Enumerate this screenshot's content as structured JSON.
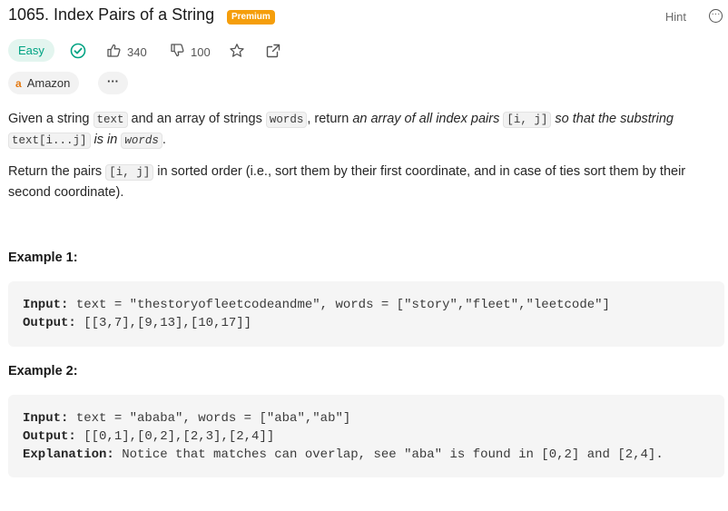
{
  "header": {
    "title": "1065. Index Pairs of a String",
    "premium_badge": "Premium",
    "hint": "Hint",
    "more_icon_text": "···"
  },
  "meta": {
    "difficulty": "Easy",
    "likes": "340",
    "dislikes": "100"
  },
  "tags": {
    "company": "Amazon",
    "company_logo": "a",
    "more": "···"
  },
  "description": {
    "p1_a": "Given a string ",
    "p1_code_text": "text",
    "p1_b": " and an array of strings ",
    "p1_code_words": "words",
    "p1_c": ", return ",
    "p1_italic_1": "an array of all index pairs ",
    "p1_code_ij": "[i, j]",
    "p1_italic_2": " so that the substring ",
    "p1_code_sub": "text[i...j]",
    "p1_italic_3": " is in ",
    "p1_code_words2": "words",
    "p1_d": ".",
    "p2_a": "Return the pairs ",
    "p2_code_ij": "[i, j]",
    "p2_b": " in sorted order (i.e., sort them by their first coordinate, and in case of ties sort them by their second coordinate)."
  },
  "examples": [
    {
      "title": "Example 1:",
      "input_label": "Input:",
      "input_value": " text = \"thestoryofleetcodeandme\", words = [\"story\",\"fleet\",\"leetcode\"]",
      "output_label": "Output:",
      "output_value": " [[3,7],[9,13],[10,17]]"
    },
    {
      "title": "Example 2:",
      "input_label": "Input:",
      "input_value": " text = \"ababa\", words = [\"aba\",\"ab\"]",
      "output_label": "Output:",
      "output_value": " [[0,1],[0,2],[2,3],[2,4]]",
      "explanation_label": "Explanation:",
      "explanation_value": " Notice that matches can overlap, see \"aba\" is found in [0,2] and [2,4]."
    }
  ],
  "colors": {
    "easy": "#00a383",
    "premium": "#f59e0b",
    "amazon": "#e47911"
  },
  "icons": [
    "check-circle-icon",
    "thumbs-up-icon",
    "thumbs-down-icon",
    "star-icon",
    "share-icon",
    "more-circle-icon"
  ]
}
